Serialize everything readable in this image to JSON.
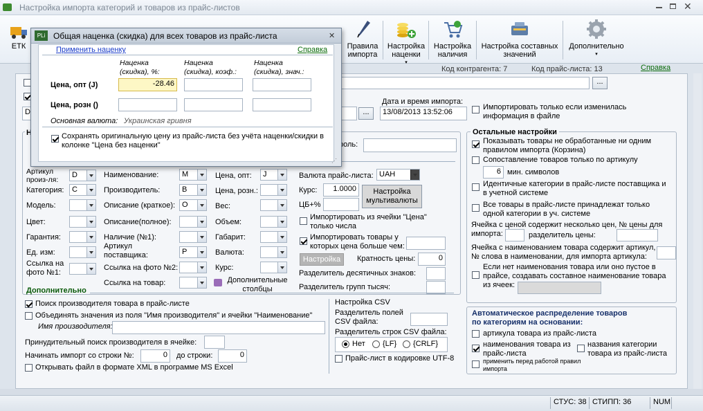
{
  "window": {
    "title": "Настройка импорта категорий и товаров из прайс-листов"
  },
  "toolbar": {
    "etk": "ЕТК",
    "buttons": [
      {
        "label": "Правила импорта",
        "icon": "feather-pen-icon"
      },
      {
        "label": "Настройка наценки",
        "icon": "coins-icon"
      },
      {
        "label": "Настройка наличия",
        "icon": "shopping-cart-icon"
      },
      {
        "label": "Настройка составных значений",
        "icon": "toolbox-icon"
      },
      {
        "label": "Дополнительно",
        "icon": "gear-icon"
      }
    ]
  },
  "infobar": {
    "contractor": "Код контрагента: 7",
    "pricelist": "Код прайс-листа: 13",
    "help": "Справка"
  },
  "dialog": {
    "title": "Общая наценка (скидка) для всех товаров из прайс-листа",
    "apply": "Применить наценку",
    "help": "Справка",
    "col1": "Наценка (скидка), %:",
    "col2": "Наценка (скидка), коэф.:",
    "col3": "Наценка (скидка), знач.:",
    "row1": "Цена, опт (J)",
    "row1_value": "-28.46",
    "row2": "Цена, розн ()",
    "currency_label": "Основная валюта:",
    "currency": "Украинская гривня",
    "keep_original": "Сохранять оригинальную цену из прайс-листа без учёта наценки/скидки в колонке \"Цена без наценки\""
  },
  "top": {
    "date_label": "Дата и время импорта:",
    "date_value": "13/08/2013 13:52:06",
    "only_changed": "Импортировать только если изменилась информация в файле",
    "dots": "..."
  },
  "mapping": {
    "left": [
      {
        "label": "Артикул произ-ля:",
        "value": "D"
      },
      {
        "label": "Категория:",
        "value": "C"
      },
      {
        "label": "Модель:",
        "value": ""
      },
      {
        "label": "Цвет:",
        "value": ""
      },
      {
        "label": "Гарантия:",
        "value": ""
      },
      {
        "label": "Ед. изм:",
        "value": ""
      },
      {
        "label": "Ссылка на фото №1:",
        "value": ""
      }
    ],
    "mid": [
      {
        "label": "Наименование:",
        "value": "M"
      },
      {
        "label": "Производитель:",
        "value": "B"
      },
      {
        "label": "Описание (краткое):",
        "value": "O"
      },
      {
        "label": "Описание(полное):",
        "value": ""
      },
      {
        "label": "Наличие (№1):",
        "value": ""
      },
      {
        "label": "Артикул поставщика:",
        "value": "P"
      },
      {
        "label": "Ссылка на фото №2:",
        "value": ""
      },
      {
        "label": "Ссылка на товар:",
        "value": ""
      }
    ],
    "right": [
      {
        "label": "Цена, опт:",
        "value": "J"
      },
      {
        "label": "Цена, розн.:",
        "value": ""
      },
      {
        "label": "Вес:",
        "value": ""
      },
      {
        "label": "Объем:",
        "value": ""
      },
      {
        "label": "Габарит:",
        "value": ""
      },
      {
        "label": "Валюта:",
        "value": ""
      },
      {
        "label": "Курс:",
        "value": ""
      }
    ],
    "extra_columns": "Дополнительные столбцы",
    "password_label": "роль:"
  },
  "currency": {
    "label": "Валюта прайс-листа:",
    "value": "UAH",
    "rate_label": "Курс:",
    "rate_value": "1.0000",
    "cb_label": "ЦБ+%",
    "multi_button": "Настройка мультивалюты",
    "import_price_cell": "Импортировать из ячейки \"Цена\" только числа",
    "import_price_more": "Импортировать товары у которых цена больше чем:",
    "setup_button": "Настройка",
    "multiplicity_label": "Кратность цены:",
    "multiplicity_value": "0",
    "decimal_sep": "Разделитель десятичных знаков:",
    "thousands_sep": "Разделитель групп тысяч:"
  },
  "additional": {
    "header": "Дополнительно",
    "find_manufacturer": "Поиск производителя товара в прайс-листе",
    "merge_fields": "Объединять значения из поля \"Имя производителя\" и ячейки \"Наименование\"",
    "manufacturer_name": "Имя производителя:",
    "force_find": "Принудительный поиск производителя в ячейке:",
    "start_row": "Начинать импорт со строки №:",
    "start_value": "0",
    "end_row": "до строки:",
    "end_value": "0",
    "open_xml": "Открывать файл в формате XML в программе MS Excel"
  },
  "csv": {
    "header": "Настройка CSV",
    "field_sep": "Разделитель полей CSV файла:",
    "row_sep": "Разделитель строк CSV файла:",
    "none": "Нет",
    "lf": "{LF}",
    "crlf": "{CRLF}",
    "utf8": "Прайс-лист в кодировке UTF-8"
  },
  "other": {
    "header": "Остальные настройки",
    "show_unprocessed": "Показывать товары не обработанные ни одним правилом импорта (Корзина)",
    "match_by_article": "Сопоставление товаров только по артикулу",
    "min_symbols_value": "6",
    "min_symbols": "мин. символов",
    "identical_categories": "Идентичные категории в прайс-листе поставщика и в учетной системе",
    "one_category": "Все товары в прайс-листе принадлежат только одной категории в уч. системе",
    "multi_price": "Ячейка с ценой содержит несколько цен, № цены для импорта:",
    "price_sep": "разделитель цены:",
    "name_article": "Ячейка с наименованием товара содержит артикул, № слова в наименовании, для импорта артикула:",
    "compose_name": "Если нет наименования товара или оно пустое в прайсе, создавать составное наименование товара из ячеек:"
  },
  "auto": {
    "header": "Автоматическое распределение товаров по категориям на основании:",
    "by_article": "артикула товара из прайс-листа",
    "by_name": "наименования товара из прайс-листа",
    "by_category": "названия категории товара из прайс-листа",
    "apply_before": "применить перед работой правил импорта"
  },
  "status": {
    "stus": "СТУС: 38",
    "stipp": "СТИПП: 36",
    "num": "NUM"
  }
}
